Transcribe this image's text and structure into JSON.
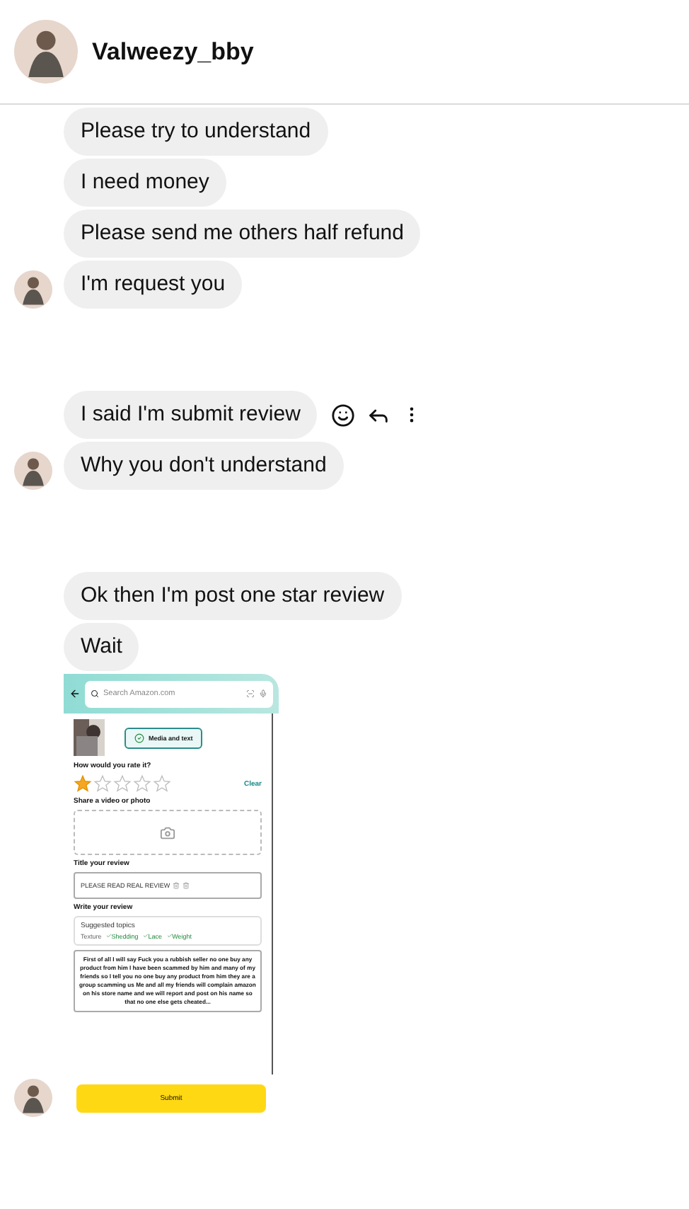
{
  "header": {
    "name": "Valweezy_bby"
  },
  "groups": [
    {
      "messages": [
        {
          "kind": "text",
          "text": "Please try to understand",
          "hovered": false
        },
        {
          "kind": "text",
          "text": "I need money",
          "hovered": false
        },
        {
          "kind": "text",
          "text": "Please send me others half refund",
          "hovered": false
        },
        {
          "kind": "text",
          "text": "I'm request you",
          "hovered": false
        }
      ]
    },
    {
      "messages": [
        {
          "kind": "text",
          "text": "I said I'm submit review",
          "hovered": true
        },
        {
          "kind": "text",
          "text": "Why you don't understand",
          "hovered": false
        }
      ]
    },
    {
      "messages": [
        {
          "kind": "text",
          "text": "Ok then I'm post one star review",
          "hovered": false
        },
        {
          "kind": "text",
          "text": "Wait",
          "hovered": false
        },
        {
          "kind": "screenshot",
          "hovered": false,
          "screenshot": {
            "search_placeholder": "Search Amazon.com",
            "tab": "Media and text",
            "rating_question": "How would you rate it?",
            "stars": 1,
            "clear": "Clear",
            "upload_label": "Share a video or photo",
            "title_label": "Title your review",
            "title_value": "PLEASE READ REAL REVIEW",
            "write_label": "Write your review",
            "topics_label": "Suggested topics",
            "topics": [
              {
                "label": "Texture",
                "checked": false
              },
              {
                "label": "Shedding",
                "checked": true
              },
              {
                "label": "Lace",
                "checked": true
              },
              {
                "label": "Weight",
                "checked": true
              }
            ],
            "review_text": "First of all I will say Fuck you a rubbish seller no one buy any product from him I have been scammed by him and many of my friends so I tell you no one buy any product from him they are a group scamming us  Me and all my friends will complain amazon on his store name and we will report and post on his name so that no one else gets cheated...",
            "submit": "Submit"
          }
        }
      ]
    }
  ]
}
